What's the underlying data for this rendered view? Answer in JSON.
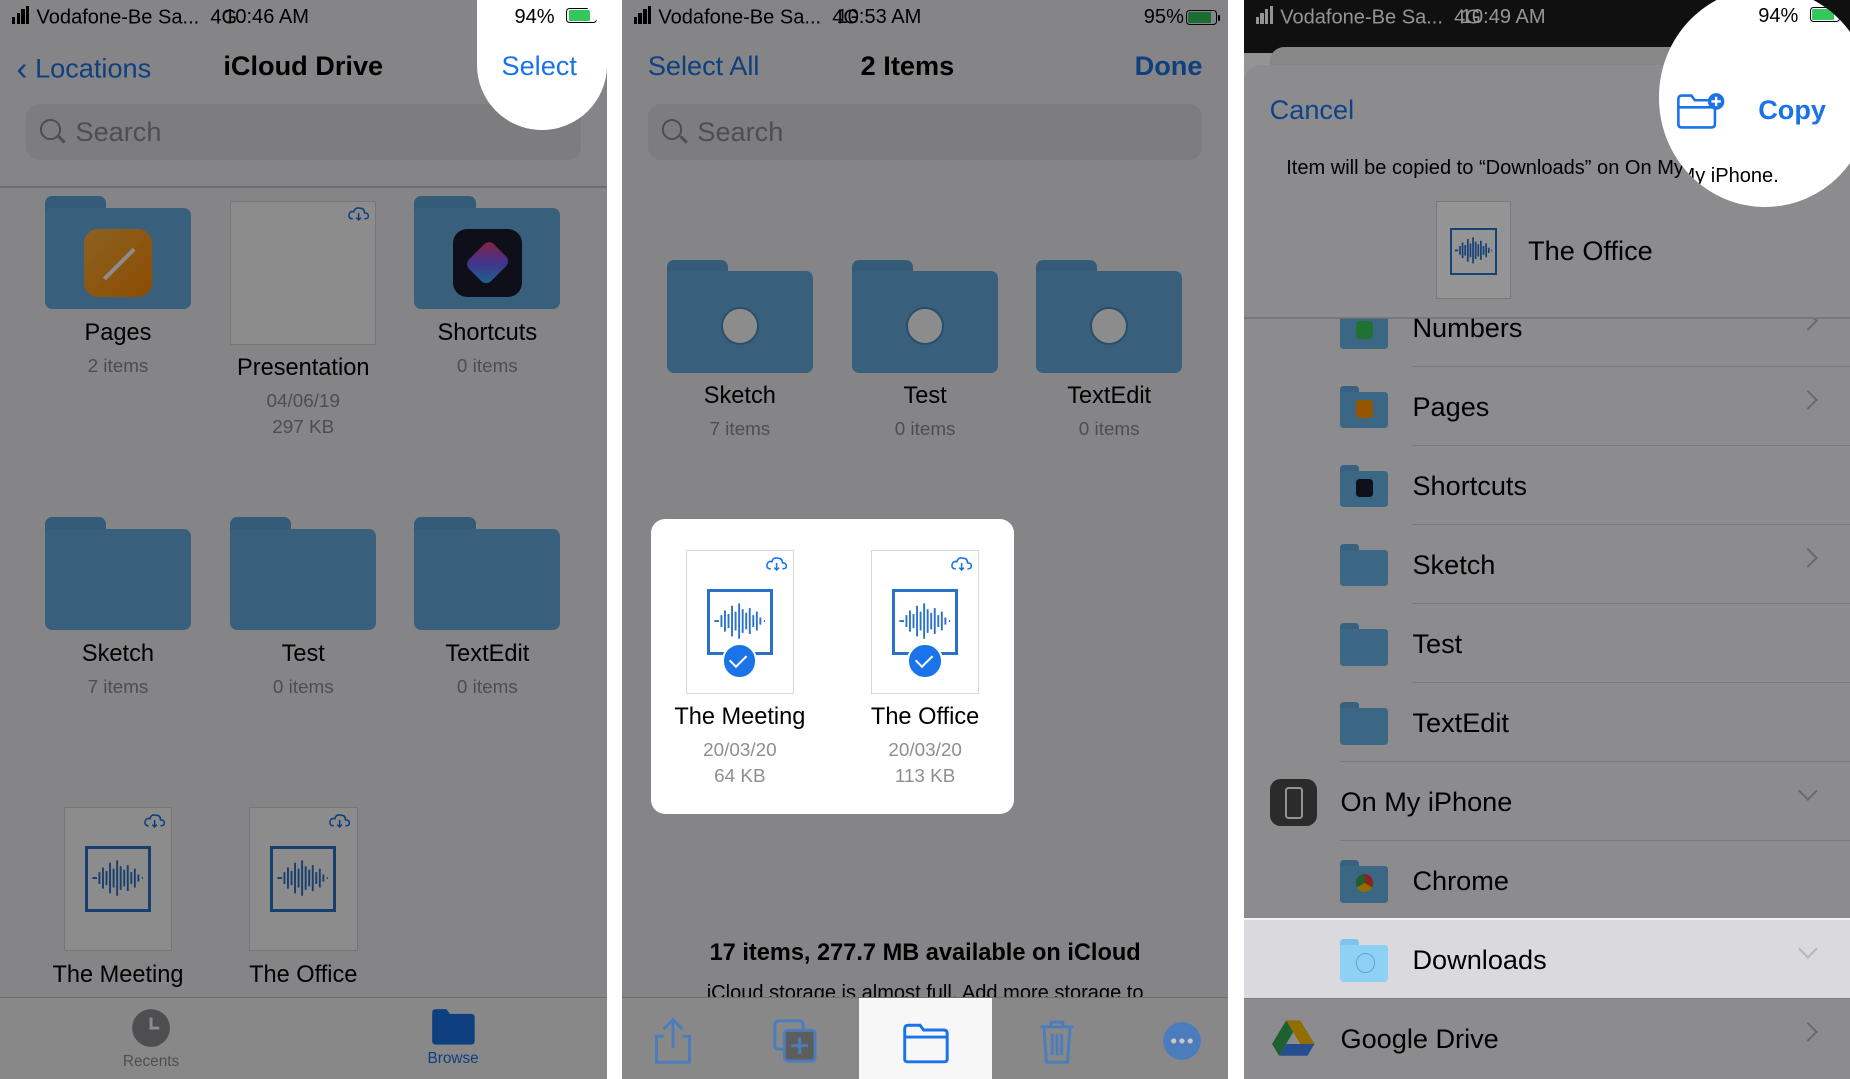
{
  "panel1": {
    "status": {
      "carrier": "Vodafone-Be Sa...",
      "network": "4G",
      "time": "10:46 AM",
      "battery": "94%"
    },
    "nav": {
      "back_label": "Locations",
      "title": "iCloud Drive",
      "select_label": "Select"
    },
    "search_placeholder": "Search",
    "tiles": [
      {
        "name": "Pages",
        "sub": "2 items"
      },
      {
        "name": "Presentation",
        "sub": "04/06/19",
        "sub2": "297 KB"
      },
      {
        "name": "Shortcuts",
        "sub": "0 items"
      },
      {
        "name": "Sketch",
        "sub": "7 items"
      },
      {
        "name": "Test",
        "sub": "0 items"
      },
      {
        "name": "TextEdit",
        "sub": "0 items"
      },
      {
        "name": "The Meeting"
      },
      {
        "name": "The Office"
      }
    ],
    "tabbar": {
      "recents": "Recents",
      "browse": "Browse"
    }
  },
  "panel2": {
    "status": {
      "carrier": "Vodafone-Be Sa...",
      "network": "4G",
      "time": "10:53 AM",
      "battery": "95%"
    },
    "nav": {
      "select_all": "Select All",
      "title": "2 Items",
      "done": "Done"
    },
    "search_placeholder": "Search",
    "folders": [
      {
        "name": "Sketch",
        "sub": "7 items"
      },
      {
        "name": "Test",
        "sub": "0 items"
      },
      {
        "name": "TextEdit",
        "sub": "0 items"
      }
    ],
    "selected": [
      {
        "name": "The Meeting",
        "date": "20/03/20",
        "size": "64 KB"
      },
      {
        "name": "The Office",
        "date": "20/03/20",
        "size": "113 KB"
      }
    ],
    "storage_title": "17 items, 277.7 MB available on iCloud",
    "storage_note": "iCloud storage is almost full. Add more storage to"
  },
  "panel3": {
    "status": {
      "carrier": "Vodafone-Be Sa...",
      "network": "4G",
      "time": "10:49 AM",
      "battery": "94%"
    },
    "cancel": "Cancel",
    "copy": "Copy",
    "message": "Item will be copied to “Downloads” on On My iPhone.",
    "item_name": "The Office",
    "rows": [
      {
        "label": "Numbers"
      },
      {
        "label": "Pages"
      },
      {
        "label": "Shortcuts"
      },
      {
        "label": "Sketch"
      },
      {
        "label": "Test"
      },
      {
        "label": "TextEdit"
      },
      {
        "label": "On My iPhone"
      },
      {
        "label": "Chrome"
      },
      {
        "label": "Downloads"
      },
      {
        "label": "Google Drive"
      }
    ]
  },
  "colors": {
    "accent": "#1a73e8",
    "folder": "#66b0e3",
    "battery_green": "#34c759"
  }
}
